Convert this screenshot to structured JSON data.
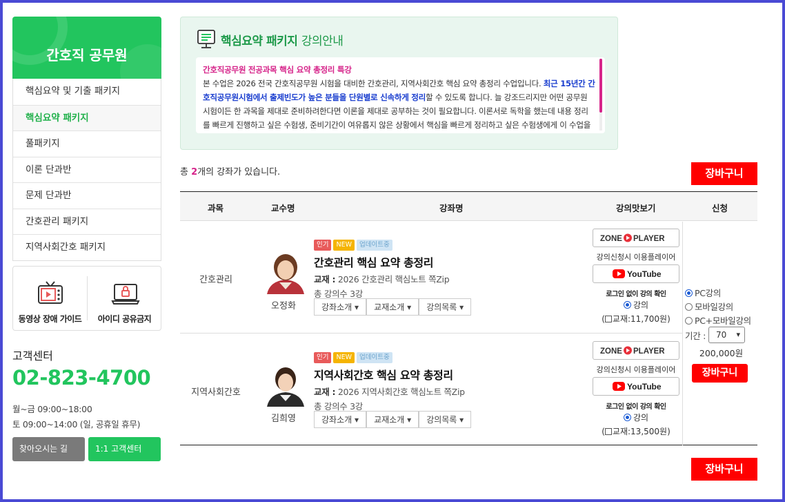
{
  "sidebar": {
    "title": "간호직 공무원",
    "items": [
      {
        "label": "핵심요약 및 기출 패키지"
      },
      {
        "label": "핵심요약 패키지"
      },
      {
        "label": "풀패키지"
      },
      {
        "label": "이론 단과반"
      },
      {
        "label": "문제 단과반"
      },
      {
        "label": "간호관리 패키지"
      },
      {
        "label": "지역사회간호 패키지"
      }
    ],
    "guide": {
      "video_label": "동영상 장애 가이드",
      "id_label": "아이디 공유금지"
    },
    "cs": {
      "title": "고객센터",
      "phone": "02-823-4700",
      "hours1": "월~금 09:00~18:00",
      "hours2": "토 09:00~14:00 (일, 공휴일 휴무)",
      "map_button": "찾아오시는 길",
      "cs_button": "1:1 고객센터"
    }
  },
  "info": {
    "title": "핵심요약 패키지",
    "title_suffix": "강의안내",
    "headline": "간호직공무원 전공과목 핵심 요약 총정리 특강",
    "p1": "본 수업은 2026 전국 간호직공무원 시험을 대비한 간호관리, 지역사회간호 핵심 요약 총정리 수업입니다. ",
    "p1_emph": "최근 15년간 간호직공무원시험에서 출제빈도가 높은 분들을 단원별로 신속하게 정리",
    "p1_tail": "할 수 있도록 합니다. 늘 강조드리지만 어떤 공무원 시험이든 한 과목을 제대로 준비하려한다면 이론을 제대로 공부하는 것이 필요합니다. 이론서로 독학을 했는데 내용 정리를 빠르게 진행하고 싶은 수험생, 준비기간이 여유롭지 않은 상황에서 핵심을 빠르게 정리하고 싶은 수험생에게 이 수업을 추천드립니다."
  },
  "list": {
    "count_prefix": "총 ",
    "count": "2",
    "count_suffix": "개의 강좌가 있습니다.",
    "cart_label": "장바구니",
    "headers": {
      "subject": "과목",
      "professor": "교수명",
      "course": "강좌명",
      "preview": "강의맛보기",
      "apply": "신청"
    },
    "badges": {
      "popular": "인기",
      "new": "NEW",
      "update": "업데이트중"
    },
    "buttons": {
      "intro": "강좌소개 ▾",
      "book": "교재소개 ▾",
      "list": "강의목록 ▾"
    },
    "preview": {
      "player_note": "강의신청시 이용플레이어",
      "login_note": "로그인 없이 강의 확인",
      "lecture_label": "강의"
    },
    "courses": [
      {
        "subject": "간호관리",
        "professor": "오정화",
        "title": "간호관리 핵심 요약 총정리",
        "book_label": "교재 :",
        "book": "2026 간호관리 핵심노트 쪽Zip",
        "count": "총 강의수 3강",
        "book_price": "교재:11,700원"
      },
      {
        "subject": "지역사회간호",
        "professor": "김희영",
        "title": "지역사회간호 핵심 요약 총정리",
        "book_label": "교재 :",
        "book": "2026 지역사회간호 핵심노트 쪽Zip",
        "count": "총 강의수 3강",
        "book_price": "교재:13,500원"
      }
    ],
    "apply": {
      "options": [
        "PC강의",
        "모바일강의",
        "PC+모바일강의"
      ],
      "period_label": "기간 :",
      "period": "70",
      "price": "200,000원",
      "cart_small": "장바구니"
    }
  },
  "colors": {
    "brand": "#22c55e",
    "accent": "#ff0000",
    "highlight": "#d6248a"
  }
}
